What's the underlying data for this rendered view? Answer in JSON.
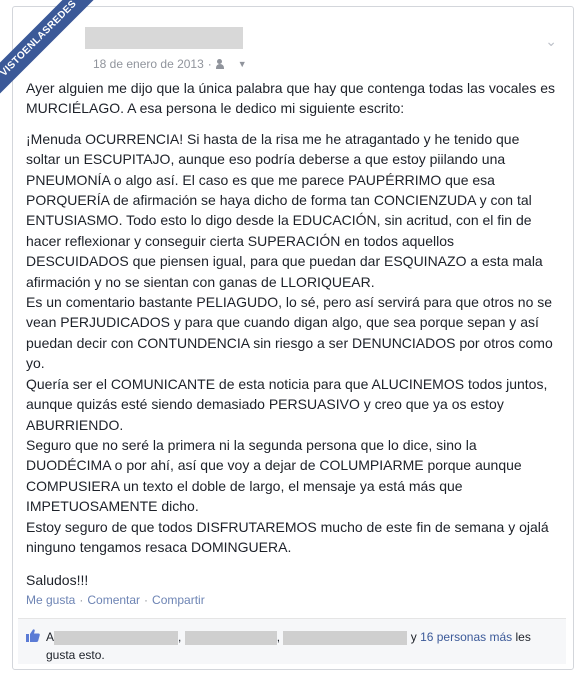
{
  "watermark": {
    "text": "VISTOENLASREDES"
  },
  "post": {
    "date": "18 de enero de 2013",
    "meta_separator": "·",
    "paragraphs": [
      "Ayer alguien me dijo que la única palabra que hay que contenga todas las vocales es MURCIÉLAGO. A esa persona le dedico mi siguiente escrito:",
      "¡Menuda OCURRENCIA! Si hasta de la risa me he atragantado y he tenido que soltar un ESCUPITAJO, aunque eso podría deberse a que estoy piilando una PNEUMONÍA o algo así. El caso es que me parece PAUPÉRRIMO que esa PORQUERÍA de afirmación se haya dicho de forma tan CONCIENZUDA y con tal ENTUSIASMO. Todo esto lo digo desde la EDUCACIÓN, sin acritud, con el fin de hacer reflexionar y conseguir cierta SUPERACIÓN en todos aquellos DESCUIDADOS que piensen igual, para que puedan dar ESQUINAZO a esta mala afirmación y no se sientan con ganas de LLORIQUEAR.\nEs un comentario bastante PELIAGUDO, lo sé, pero así servirá para que otros no se vean PERJUDICADOS y para que cuando digan algo, que sea porque sepan y así puedan decir con CONTUNDENCIA sin riesgo a ser DENUNCIADOS por otros como yo.\nQuería ser el COMUNICANTE de esta noticia para que ALUCINEMOS todos juntos, aunque quizás esté siendo demasiado PERSUASIVO y creo que ya os estoy ABURRIENDO.\nSeguro que no seré la primera ni la segunda persona que lo dice, sino la DUODÉCIMA o por ahí, así que voy a dejar de COLUMPIARME porque aunque COMPUSIERA un texto el doble de largo, el mensaje ya está más que IMPETUOSAMENTE dicho.\nEstoy seguro de que todos DISFRUTAREMOS mucho de este fin de semana y ojalá ninguno tengamos resaca DOMINGUERA.",
      "Saludos!!!"
    ],
    "actions": {
      "like": "Me gusta",
      "comment": "Comentar",
      "share": "Compartir",
      "separator": "·"
    },
    "likes": {
      "prefix": "A",
      "sep1": ",",
      "sep2": ",",
      "conjunction": "y",
      "others_link": "16 personas más",
      "suffix": "les gusta esto."
    }
  },
  "colors": {
    "link": "#3b5998",
    "action": "#6d84b4",
    "meta": "#90949c",
    "redaction": "#d8d8d8"
  }
}
